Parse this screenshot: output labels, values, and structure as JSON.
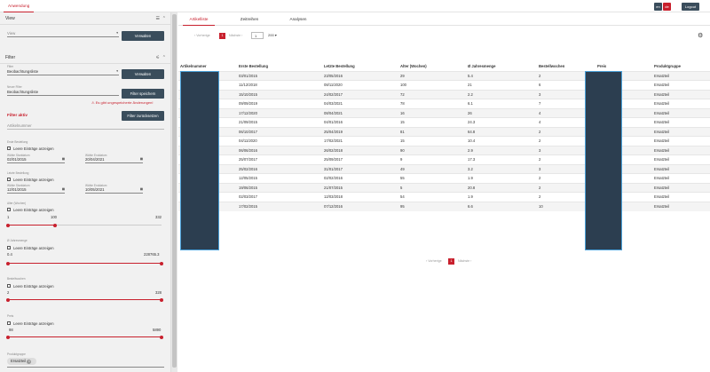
{
  "app": {
    "tab": "Anwendung",
    "lang_en": "en",
    "lang_de": "de",
    "logout": "Logout",
    "colors": {
      "accent": "#c8202d",
      "dark": "#3a4d5c",
      "header": "#2c3e50"
    }
  },
  "view": {
    "title": "View",
    "field_label": "View",
    "manage_btn": "Verwalten"
  },
  "filter": {
    "title": "Filter",
    "filter_label": "Filter",
    "filter_value": "Beobachtungsliste",
    "manage_btn": "Verwalten",
    "new_label": "Neuer Filter",
    "new_value": "Beobachtungsliste",
    "save_btn": "Filter speichern",
    "warning": "Es gibt ungespeicherte Änderungen!",
    "active": "Filter aktiv",
    "reset_btn": "Filter zurücksetzen",
    "article_placeholder": "Artikelnummer"
  },
  "first_order": {
    "label": "Erste Bestellung",
    "show_empty": "Leere Einträge anzeigen",
    "start_label": "Wähle Startdatum",
    "start": "02/01/2015",
    "end_label": "Wähle Enddatum",
    "end": "20/04/2021"
  },
  "last_order": {
    "label": "Letzte Bestellung",
    "show_empty": "Leere Einträge anzeigen",
    "start_label": "Wähle Startdatum",
    "start": "12/01/2015",
    "end_label": "Wähle Enddatum",
    "end": "10/05/2021"
  },
  "age": {
    "label": "Alter (Wochen)",
    "show_empty": "Leere Einträge anzeigen",
    "min": "1",
    "mid": "100",
    "max": "332",
    "value_fraction": 0.3
  },
  "yearly": {
    "label": "Ø Jahresmenge",
    "show_empty": "Leere Einträge anzeigen",
    "min": "0.4",
    "max": "228765.3"
  },
  "weeks": {
    "label": "Bestellwochen",
    "show_empty": "Leere Einträge anzeigen",
    "min": "2",
    "max": "328"
  },
  "price": {
    "label": "Preis",
    "show_empty": "Leere Einträge anzeigen",
    "min": "98",
    "max": "5890"
  },
  "group": {
    "label": "Produktgruppe",
    "chip": "Ersatzteil"
  },
  "tabs": [
    "Artikelliste",
    "Zeitreihen",
    "Analysen"
  ],
  "pager": {
    "prev": "Vorherige",
    "page": "1",
    "next": "Nächste",
    "goto": "1",
    "size": "200"
  },
  "table": {
    "headers": [
      "Artikelnummer",
      "Erste Bestellung",
      "Letzte Bestellung",
      "Alter (Wochen)",
      "Ø Jahresmenge",
      "Bestellwochen",
      "Preis",
      "Produktgruppe"
    ],
    "rows": [
      [
        "03/01/2015",
        "23/05/2016",
        "29",
        "5.4",
        "2",
        "Ersatzteil"
      ],
      [
        "11/12/2018",
        "08/11/2020",
        "100",
        "21",
        "6",
        "Ersatzteil"
      ],
      [
        "15/10/2015",
        "24/02/2017",
        "72",
        "2.2",
        "3",
        "Ersatzteil"
      ],
      [
        "09/09/2019",
        "04/03/2021",
        "78",
        "6.1",
        "7",
        "Ersatzteil"
      ],
      [
        "17/12/2020",
        "08/04/2021",
        "16",
        "26",
        "4",
        "Ersatzteil"
      ],
      [
        "21/09/2015",
        "04/01/2016",
        "15",
        "24.3",
        "4",
        "Ersatzteil"
      ],
      [
        "06/10/2017",
        "25/04/2019",
        "81",
        "64.8",
        "2",
        "Ersatzteil"
      ],
      [
        "04/11/2020",
        "17/02/2021",
        "15",
        "10.4",
        "2",
        "Ersatzteil"
      ],
      [
        "06/06/2016",
        "26/02/2018",
        "90",
        "2.9",
        "3",
        "Ersatzteil"
      ],
      [
        "25/07/2017",
        "25/09/2017",
        "9",
        "17.3",
        "2",
        "Ersatzteil"
      ],
      [
        "25/02/2016",
        "31/01/2017",
        "49",
        "3.2",
        "3",
        "Ersatzteil"
      ],
      [
        "12/05/2015",
        "02/02/2016",
        "55",
        "1.9",
        "2",
        "Ersatzteil"
      ],
      [
        "19/06/2015",
        "21/07/2015",
        "5",
        "20.8",
        "2",
        "Ersatzteil"
      ],
      [
        "02/03/2017",
        "12/03/2018",
        "54",
        "1.9",
        "2",
        "Ersatzteil"
      ],
      [
        "17/02/2015",
        "07/12/2016",
        "95",
        "6.6",
        "10",
        "Ersatzteil"
      ]
    ]
  }
}
